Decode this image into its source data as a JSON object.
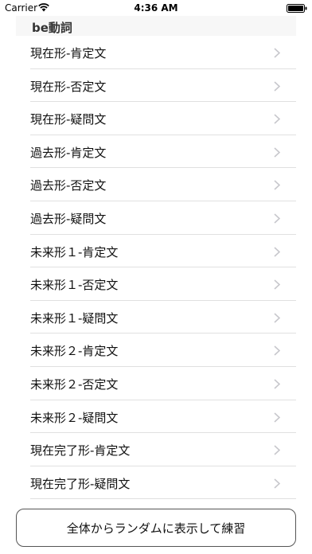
{
  "status_bar": {
    "carrier": "Carrier",
    "time": "4:36 AM"
  },
  "section": {
    "title": "be動詞"
  },
  "items": [
    {
      "label": "現在形-肯定文"
    },
    {
      "label": "現在形-否定文"
    },
    {
      "label": "現在形-疑問文"
    },
    {
      "label": "過去形-肯定文"
    },
    {
      "label": "過去形-否定文"
    },
    {
      "label": "過去形-疑問文"
    },
    {
      "label": "未来形１-肯定文"
    },
    {
      "label": "未来形１-否定文"
    },
    {
      "label": "未来形１-疑問文"
    },
    {
      "label": "未来形２-肯定文"
    },
    {
      "label": "未来形２-否定文"
    },
    {
      "label": "未来形２-疑問文"
    },
    {
      "label": "現在完了形-肯定文"
    },
    {
      "label": "現在完了形-疑問文"
    }
  ],
  "random_button": {
    "label": "全体からランダムに表示して練習"
  }
}
